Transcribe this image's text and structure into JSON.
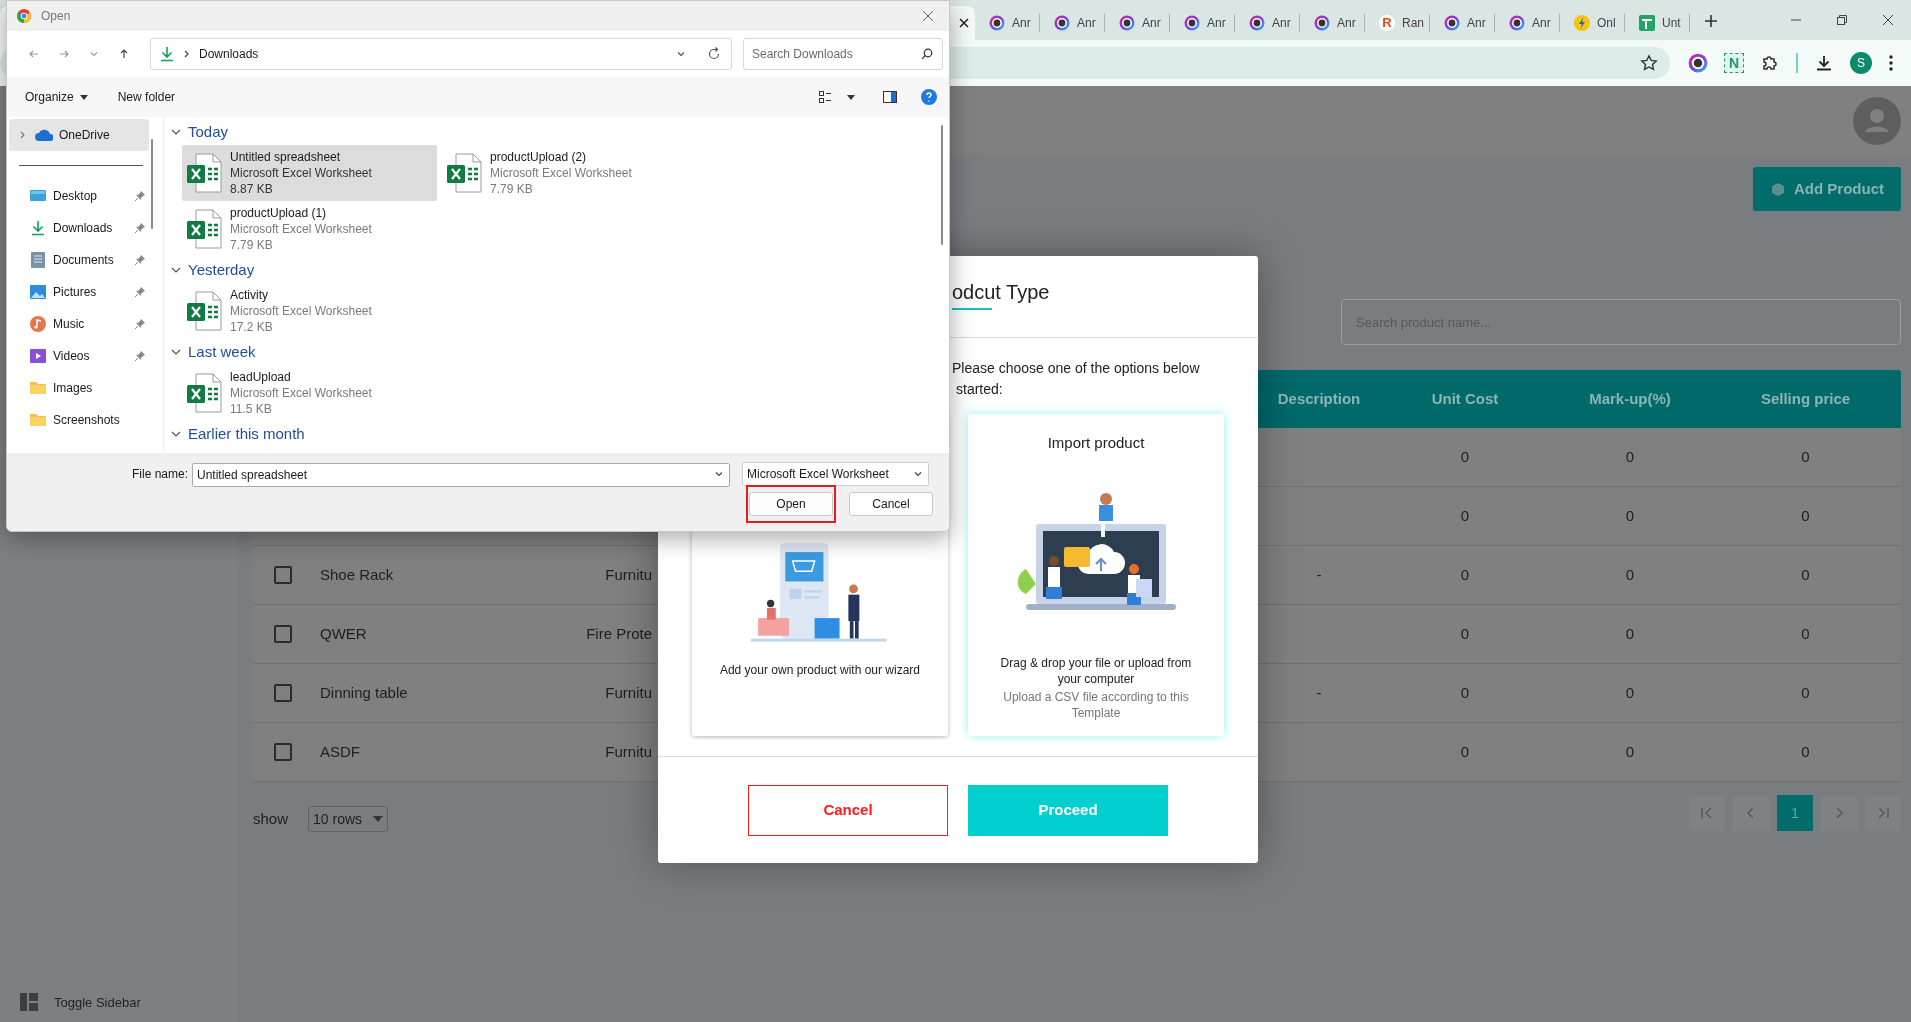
{
  "browser": {
    "tabs": [
      {
        "selected": true
      },
      {
        "label": "Anr",
        "kind": "lens",
        "selected": false
      },
      {
        "label": "Anr",
        "kind": "lens",
        "selected": false
      },
      {
        "label": "Anr",
        "kind": "lens",
        "selected": false
      },
      {
        "label": "Anr",
        "kind": "lens",
        "selected": false
      },
      {
        "label": "Anr",
        "kind": "lens",
        "selected": false
      },
      {
        "label": "Anr",
        "kind": "lens",
        "selected": false
      },
      {
        "label": "Ran",
        "kind": "letter",
        "logo": "R",
        "selected": false
      },
      {
        "label": "Anr",
        "kind": "lens",
        "selected": false
      },
      {
        "label": "Anr",
        "kind": "lens",
        "selected": false
      },
      {
        "label": "Onl",
        "kind": "bolt",
        "selected": false
      },
      {
        "label": "Unt",
        "kind": "sheet",
        "selected": false
      }
    ],
    "extension_letter": "N",
    "profile": "S"
  },
  "page": {
    "add_product": "Add Product",
    "search_placeholder": "Search product name...",
    "table": {
      "columns": [
        "Description",
        "Unit Cost",
        "Mark-up(%)",
        "Selling price"
      ],
      "rows": [
        {
          "unit_cost": "0",
          "markup": "0",
          "selling_price": "0"
        },
        {
          "unit_cost": "0",
          "markup": "0",
          "selling_price": "0"
        },
        {
          "checked": false,
          "name": "Shoe Rack",
          "category": "Furnitu",
          "description": "-",
          "unit_cost": "0",
          "markup": "0",
          "selling_price": "0"
        },
        {
          "checked": false,
          "name": "QWER",
          "category": "Fire Prote",
          "unit_cost": "0",
          "markup": "0",
          "selling_price": "0"
        },
        {
          "checked": false,
          "name": "Dinning table",
          "category": "Furnitu",
          "description": "-",
          "unit_cost": "0",
          "markup": "0",
          "selling_price": "0"
        },
        {
          "checked": false,
          "name": "ASDF",
          "category": "Furnitu",
          "unit_cost": "0",
          "markup": "0",
          "selling_price": "0"
        }
      ]
    },
    "show_label": "show",
    "rows_per_page": "10 rows",
    "pages": [
      {
        "label": "1",
        "selected": true
      }
    ],
    "toggle_sidebar": "Toggle Sidebar"
  },
  "modal": {
    "title": "odcut Type",
    "intro": [
      "Please choose one of the options below",
      "started:"
    ],
    "options": [
      {
        "kind": "wizard",
        "text": "Add your own product with our wizard",
        "selected": false
      },
      {
        "kind": "import",
        "title": "Import product",
        "text": "Drag & drop your file or upload from your computer",
        "hint": "Upload a CSV file according to this Template",
        "selected": true
      }
    ],
    "buttons": [
      {
        "label": "Cancel",
        "kind": "outline"
      },
      {
        "label": "Proceed",
        "kind": "primary"
      }
    ]
  },
  "dialog": {
    "title": "Open",
    "location": "Downloads",
    "search_placeholder": "Search Downloads",
    "commands": [
      "Organize",
      "New folder"
    ],
    "nav": [
      {
        "label": "OneDrive",
        "kind": "cloud",
        "selected": true,
        "pinned": false
      },
      {
        "label": "Desktop",
        "kind": "desktop",
        "selected": false,
        "pinned": true
      },
      {
        "label": "Downloads",
        "kind": "download",
        "selected": false,
        "pinned": true
      },
      {
        "label": "Documents",
        "kind": "documents",
        "selected": false,
        "pinned": true
      },
      {
        "label": "Pictures",
        "kind": "pictures",
        "selected": false,
        "pinned": true
      },
      {
        "label": "Music",
        "kind": "music",
        "selected": false,
        "pinned": true
      },
      {
        "label": "Videos",
        "kind": "videos",
        "selected": false,
        "pinned": true
      },
      {
        "label": "Images",
        "kind": "folder",
        "selected": false,
        "pinned": false
      },
      {
        "label": "Screenshots",
        "kind": "folder",
        "selected": false,
        "pinned": false
      }
    ],
    "groups": [
      {
        "label": "Today",
        "files": [
          {
            "name": "Untitled spreadsheet",
            "type": "Microsoft Excel Worksheet",
            "size": "8.87 KB",
            "selected": true
          },
          {
            "name": "productUpload (2)",
            "type": "Microsoft Excel Worksheet",
            "size": "7.79 KB",
            "selected": false
          },
          {
            "name": "productUpload (1)",
            "type": "Microsoft Excel Worksheet",
            "size": "7.79 KB",
            "selected": false
          }
        ]
      },
      {
        "label": "Yesterday",
        "files": [
          {
            "name": "Activity",
            "type": "Microsoft Excel Worksheet",
            "size": "17.2 KB",
            "selected": false
          }
        ]
      },
      {
        "label": "Last week",
        "files": [
          {
            "name": "leadUpload",
            "type": "Microsoft Excel Worksheet",
            "size": "11.5 KB",
            "selected": false
          }
        ]
      },
      {
        "label": "Earlier this month"
      }
    ],
    "file_name_label": "File name:",
    "file_name": "Untitled spreadsheet",
    "file_type": "Microsoft Excel Worksheet",
    "buttons": [
      {
        "label": "Open",
        "highlighted": true
      },
      {
        "label": "Cancel",
        "highlighted": false
      }
    ]
  }
}
